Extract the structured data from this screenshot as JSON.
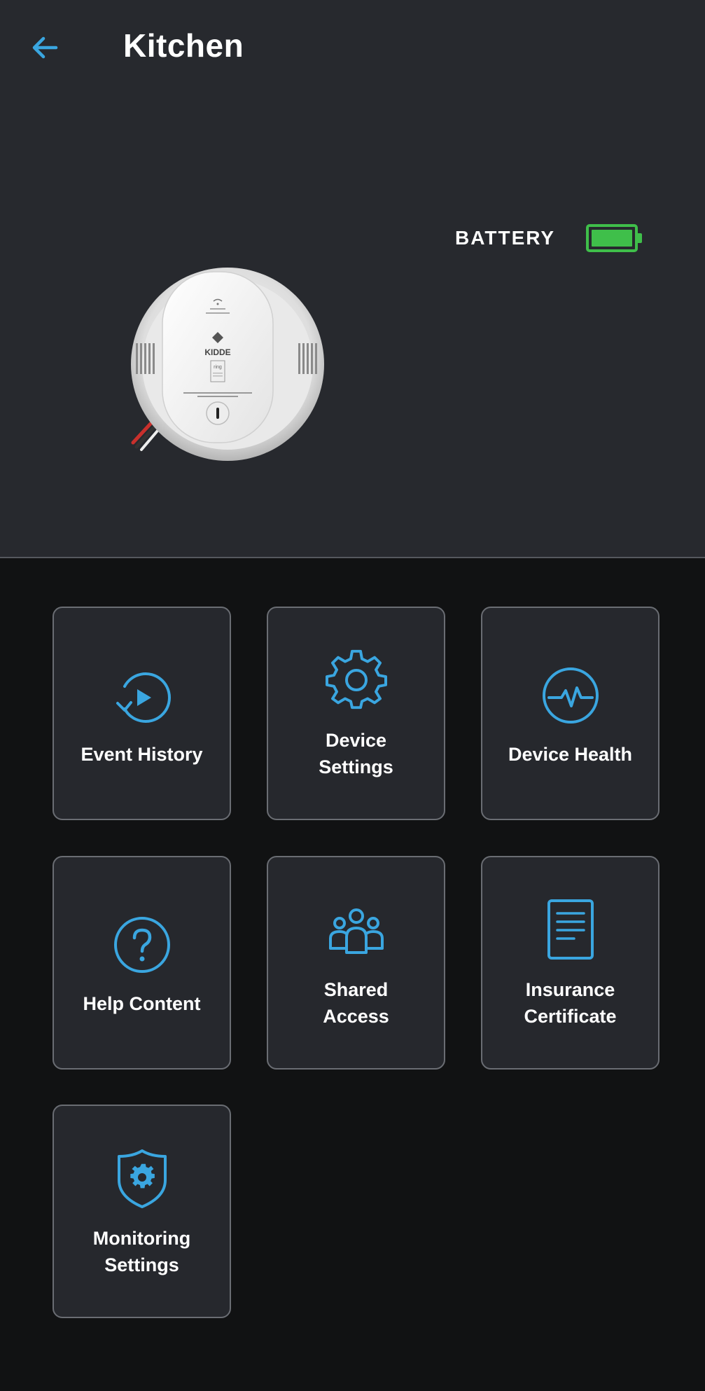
{
  "header": {
    "title": "Kitchen",
    "back_icon": "arrow-left-icon"
  },
  "device": {
    "battery_label": "BATTERY",
    "battery_level": 1.0,
    "battery_color": "#3fbf4a",
    "image_icon": "smoke-alarm-image",
    "brand_text": "KIDDE",
    "sub_brand_text": "ring"
  },
  "colors": {
    "accent": "#3aa6e0",
    "hero_bg": "#27292e",
    "page_bg": "#111213",
    "tile_bg": "#26282d",
    "tile_border": "#6a6d73"
  },
  "tiles": [
    {
      "icon": "history-play-icon",
      "line1": "Event History",
      "line2": ""
    },
    {
      "icon": "gear-icon",
      "line1": "Device",
      "line2": "Settings"
    },
    {
      "icon": "pulse-icon",
      "line1": "Device Health",
      "line2": ""
    },
    {
      "icon": "question-icon",
      "line1": "Help Content",
      "line2": ""
    },
    {
      "icon": "people-icon",
      "line1": "Shared",
      "line2": "Access"
    },
    {
      "icon": "document-icon",
      "line1": "Insurance",
      "line2": "Certificate"
    },
    {
      "icon": "shield-gear-icon",
      "line1": "Monitoring",
      "line2": "Settings"
    }
  ]
}
